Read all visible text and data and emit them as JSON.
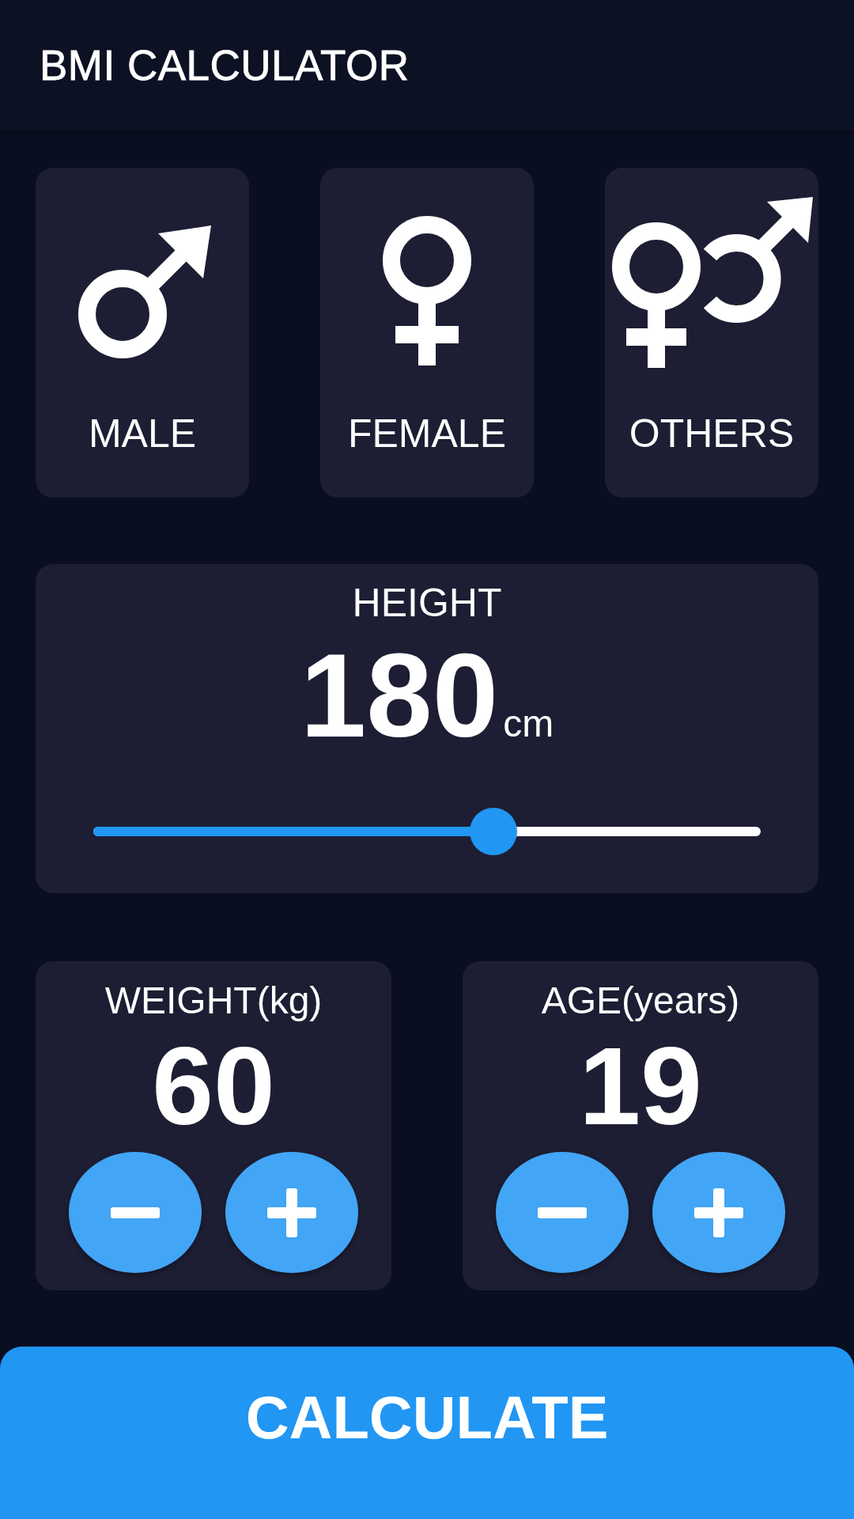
{
  "app_bar": {
    "title": "BMI CALCULATOR"
  },
  "genders": [
    {
      "kind": "male",
      "label": "MALE"
    },
    {
      "kind": "female",
      "label": "FEMALE"
    },
    {
      "kind": "others",
      "label": "OTHERS"
    }
  ],
  "height": {
    "label": "HEIGHT",
    "value": "180",
    "unit": "cm",
    "level": 0.6
  },
  "counters": [
    {
      "label": "WEIGHT(kg)",
      "value": "60"
    },
    {
      "label": "AGE(years)",
      "value": "19"
    }
  ],
  "calculate_button": "CALCULATE"
}
